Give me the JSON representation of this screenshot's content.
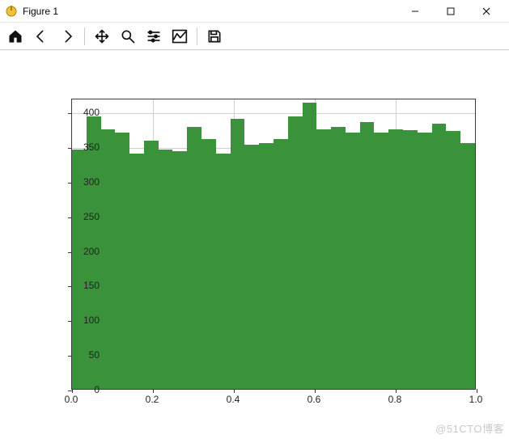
{
  "window": {
    "title": "Figure 1"
  },
  "toolbar": {
    "home": "home-icon",
    "back": "back-icon",
    "forward": "forward-icon",
    "pan": "pan-icon",
    "zoom": "zoom-icon",
    "subplots": "subplots-icon",
    "edit": "edit-icon",
    "save": "save-icon"
  },
  "watermark": "@51CTO博客",
  "chart_data": {
    "type": "bar",
    "title": "",
    "xlabel": "",
    "ylabel": "",
    "xlim": [
      0.0,
      1.0
    ],
    "ylim": [
      0,
      420
    ],
    "xticks": [
      0.0,
      0.2,
      0.4,
      0.6,
      0.8,
      1.0
    ],
    "yticks": [
      0,
      50,
      100,
      150,
      200,
      250,
      300,
      350,
      400
    ],
    "grid": true,
    "bar_color": "#3a923a",
    "bin_edges": [
      0.0,
      0.037,
      0.074,
      0.111,
      0.148,
      0.185,
      0.222,
      0.259,
      0.296,
      0.333,
      0.37,
      0.407,
      0.444,
      0.481,
      0.519,
      0.556,
      0.593,
      0.63,
      0.667,
      0.704,
      0.741,
      0.778,
      0.815,
      0.852,
      0.889,
      0.926,
      0.963,
      1.0
    ],
    "values": [
      345,
      393,
      375,
      370,
      340,
      358,
      345,
      343,
      378,
      360,
      340,
      390,
      352,
      355,
      360,
      393,
      413,
      375,
      378,
      370,
      385,
      370,
      374,
      373,
      370,
      383,
      372,
      355
    ]
  }
}
